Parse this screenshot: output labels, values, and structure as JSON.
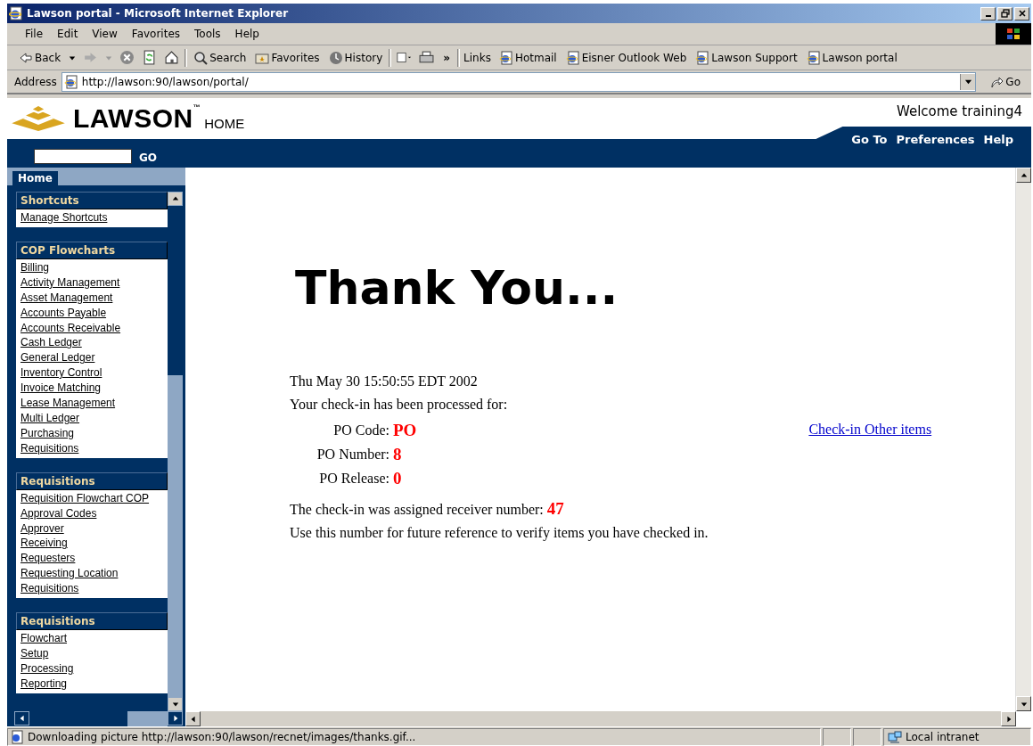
{
  "window": {
    "title": "Lawson portal - Microsoft Internet Explorer"
  },
  "menu": [
    "File",
    "Edit",
    "View",
    "Favorites",
    "Tools",
    "Help"
  ],
  "toolbar": {
    "back": "Back",
    "search": "Search",
    "favorites": "Favorites",
    "history": "History",
    "more": "»",
    "links_label": "Links"
  },
  "links": [
    "Hotmail",
    "Eisner Outlook Web",
    "Lawson Support",
    "Lawson portal"
  ],
  "address": {
    "label": "Address",
    "url": "http://lawson:90/lawson/portal/",
    "go": "Go"
  },
  "portal": {
    "brand": "LAWSON",
    "tm": "™",
    "home": "HOME",
    "welcome": "Welcome training4",
    "nav": [
      "Go To",
      "Preferences",
      "Help"
    ],
    "search_go": "GO",
    "tabs": [
      {
        "label": "Home",
        "selected": true
      }
    ]
  },
  "sidebar": {
    "groups": [
      {
        "title": "Shortcuts",
        "items": [
          "Manage Shortcuts"
        ]
      },
      {
        "title": "COP Flowcharts",
        "items": [
          "Billing",
          "Activity Management",
          "Asset Management",
          "Accounts Payable",
          "Accounts Receivable",
          "Cash Ledger",
          "General Ledger",
          "Inventory Control",
          "Invoice Matching",
          "Lease Management",
          "Multi Ledger",
          "Purchasing",
          "Requisitions"
        ]
      },
      {
        "title": "Requisitions",
        "items": [
          "Requisition Flowchart COP",
          "Approval Codes",
          "Approver",
          "Receiving",
          "Requesters",
          "Requesting Location",
          "Requisitions"
        ]
      },
      {
        "title": "Requisitions",
        "items": [
          "Flowchart",
          "Setup",
          "Processing",
          "Reporting"
        ]
      }
    ]
  },
  "content": {
    "heading": "Thank You...",
    "date": "Thu May 30 15:50:55 EDT 2002",
    "intro": "Your check-in has been processed for:",
    "fields": [
      {
        "label": "PO Code:",
        "value": "PO"
      },
      {
        "label": "PO Number:",
        "value": "8"
      },
      {
        "label": "PO Release:",
        "value": "0"
      }
    ],
    "receiver_label": "The check-in was assigned receiver number:",
    "receiver_value": "47",
    "note": "Use this number for future reference to verify items you have checked in.",
    "link": "Check-in Other items"
  },
  "status_bar": {
    "text": "Downloading picture http://lawson:90/lawson/recnet/images/thanks.gif...",
    "zone": "Local intranet"
  }
}
